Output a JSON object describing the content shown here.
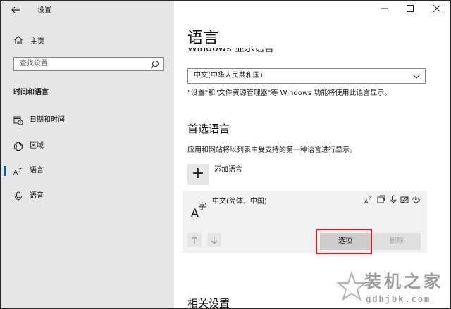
{
  "window": {
    "title": "设置"
  },
  "sidebar": {
    "home_label": "主页",
    "search_placeholder": "查找设置",
    "section_heading": "时间和语言",
    "items": [
      {
        "label": "日期和时间",
        "icon": "calendar-clock-icon",
        "selected": false
      },
      {
        "label": "区域",
        "icon": "globe-icon",
        "selected": false
      },
      {
        "label": "语言",
        "icon": "language-icon",
        "selected": true
      },
      {
        "label": "语音",
        "icon": "microphone-icon",
        "selected": false
      }
    ]
  },
  "main": {
    "page_title": "语言",
    "display_language_heading": "Windows 显示语言",
    "display_language_value": "中文(中华人民共和国)",
    "display_language_desc": "\"设置\"和\"文件资源管理器\"等 Windows 功能将使用此语言显示。",
    "preferred_heading": "首选语言",
    "preferred_desc": "应用和网站将以列表中受支持的第一种语言进行显示。",
    "add_language_label": "添加语言",
    "language_card": {
      "name": "中文(简体，中国)",
      "feature_icons": [
        "display-language-icon",
        "text-to-speech-icon",
        "speech-recognition-icon",
        "handwriting-icon",
        "spell-check-icon"
      ],
      "options_label": "选项",
      "remove_label": "删除"
    },
    "related_heading": "相关设置"
  },
  "watermark": {
    "text": "装机之家",
    "url": "gdhjbk.com"
  },
  "colors": {
    "accent": "#0063b1",
    "highlight": "#e21b1b"
  }
}
